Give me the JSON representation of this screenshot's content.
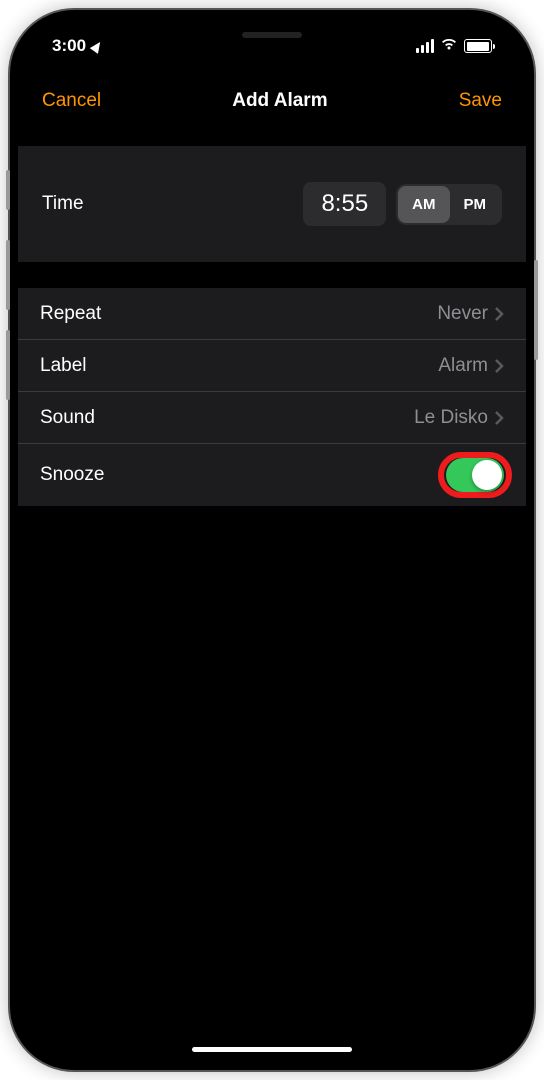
{
  "statusBar": {
    "time": "3:00"
  },
  "nav": {
    "cancel": "Cancel",
    "title": "Add Alarm",
    "save": "Save"
  },
  "timeSection": {
    "label": "Time",
    "value": "8:55",
    "am": "AM",
    "pm": "PM",
    "selected": "AM"
  },
  "rows": {
    "repeat": {
      "label": "Repeat",
      "value": "Never"
    },
    "label": {
      "label": "Label",
      "value": "Alarm"
    },
    "sound": {
      "label": "Sound",
      "value": "Le Disko"
    },
    "snooze": {
      "label": "Snooze",
      "enabled": true
    }
  }
}
